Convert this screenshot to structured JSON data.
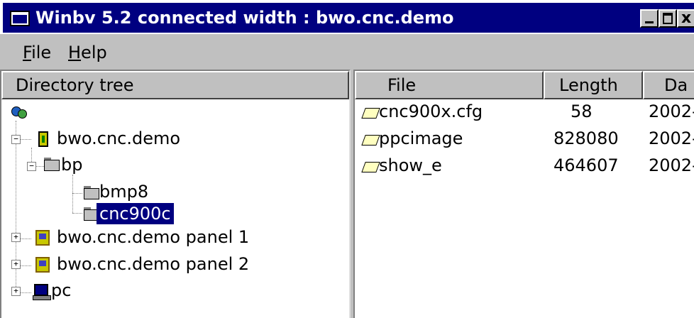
{
  "window": {
    "title": "Winbv 5.2 connected width : bwo.cnc.demo",
    "controls": {
      "close": "x"
    }
  },
  "menu": [
    {
      "label": "File",
      "underline": "F",
      "rest": "ile"
    },
    {
      "label": "Help",
      "underline": "H",
      "rest": "elp"
    }
  ],
  "tree": {
    "header": "Directory tree",
    "nodes": [
      {
        "label": "bwo.cnc.demo",
        "toggle": "−",
        "icon": "device-icon"
      },
      {
        "label": "bp",
        "toggle": "−",
        "icon": "folder-icon"
      },
      {
        "label": "bmp8",
        "icon": "folder-icon"
      },
      {
        "label": "cnc900c",
        "icon": "folder-icon",
        "selected": true
      },
      {
        "label": "bwo.cnc.demo panel 1",
        "toggle": "+",
        "icon": "panel-icon"
      },
      {
        "label": "bwo.cnc.demo panel 2",
        "toggle": "+",
        "icon": "panel-icon"
      },
      {
        "label": "pc",
        "toggle": "+",
        "icon": "pc-icon"
      }
    ]
  },
  "files": {
    "columns": [
      "File",
      "Length",
      "Da"
    ],
    "rows": [
      {
        "name": "cnc900x.cfg",
        "length": "58",
        "date": "2002-"
      },
      {
        "name": "ppcimage",
        "length": "828080",
        "date": "2002-"
      },
      {
        "name": "show_e",
        "length": "464607",
        "date": "2002-"
      }
    ]
  }
}
